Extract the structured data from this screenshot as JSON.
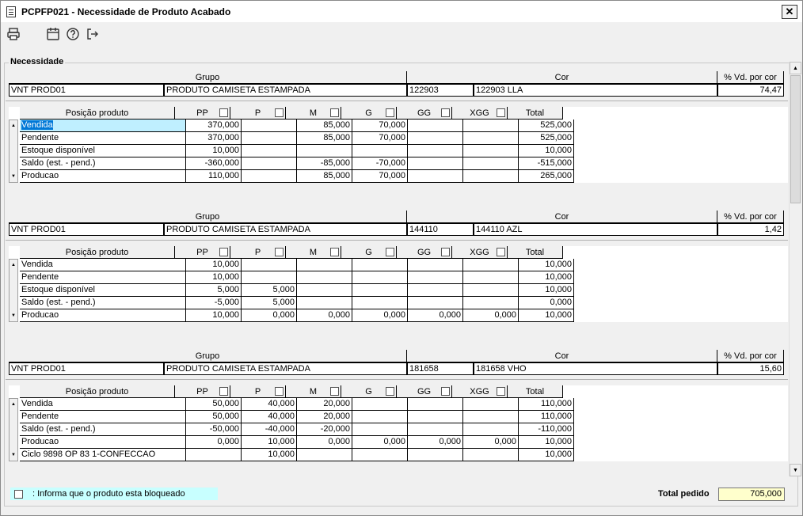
{
  "window": {
    "title": "PCPFP021 - Necessidade de Produto Acabado",
    "close_label": "✕"
  },
  "toolbar": {
    "icons": [
      "printer-icon",
      "calendar-icon",
      "help-icon",
      "exit-icon"
    ]
  },
  "groupbox_label": "Necessidade",
  "headers": {
    "grupo": "Grupo",
    "cor": "Cor",
    "pct": "% Vd. por cor"
  },
  "grid_columns": [
    "Posição produto",
    "PP",
    "P",
    "M",
    "G",
    "GG",
    "XGG",
    "Total"
  ],
  "blocks": [
    {
      "grupo_code": "VNT PROD01",
      "grupo_desc": "PRODUTO CAMISETA ESTAMPADA",
      "cor_code": "122903",
      "cor_desc": "122903 LLA",
      "pct": "74,47",
      "rows": [
        [
          "Vendida",
          "370,000",
          "",
          "85,000",
          "70,000",
          "",
          "",
          "525,000"
        ],
        [
          "Pendente",
          "370,000",
          "",
          "85,000",
          "70,000",
          "",
          "",
          "525,000"
        ],
        [
          "Estoque disponível",
          "10,000",
          "",
          "",
          "",
          "",
          "",
          "10,000"
        ],
        [
          "Saldo (est. - pend.)",
          "-360,000",
          "",
          "-85,000",
          "-70,000",
          "",
          "",
          "-515,000"
        ],
        [
          "Producao",
          "110,000",
          "",
          "85,000",
          "70,000",
          "",
          "",
          "265,000"
        ]
      ]
    },
    {
      "grupo_code": "VNT PROD01",
      "grupo_desc": "PRODUTO CAMISETA ESTAMPADA",
      "cor_code": "144110",
      "cor_desc": "144110 AZL",
      "pct": "1,42",
      "rows": [
        [
          "Vendida",
          "10,000",
          "",
          "",
          "",
          "",
          "",
          "10,000"
        ],
        [
          "Pendente",
          "10,000",
          "",
          "",
          "",
          "",
          "",
          "10,000"
        ],
        [
          "Estoque disponível",
          "5,000",
          "5,000",
          "",
          "",
          "",
          "",
          "10,000"
        ],
        [
          "Saldo (est. - pend.)",
          "-5,000",
          "5,000",
          "",
          "",
          "",
          "",
          "0,000"
        ],
        [
          "Producao",
          "10,000",
          "0,000",
          "0,000",
          "0,000",
          "0,000",
          "0,000",
          "10,000"
        ]
      ]
    },
    {
      "grupo_code": "VNT PROD01",
      "grupo_desc": "PRODUTO CAMISETA ESTAMPADA",
      "cor_code": "181658",
      "cor_desc": "181658 VHO",
      "pct": "15,60",
      "rows": [
        [
          "Vendida",
          "50,000",
          "40,000",
          "20,000",
          "",
          "",
          "",
          "110,000"
        ],
        [
          "Pendente",
          "50,000",
          "40,000",
          "20,000",
          "",
          "",
          "",
          "110,000"
        ],
        [
          "Saldo (est. - pend.)",
          "-50,000",
          "-40,000",
          "-20,000",
          "",
          "",
          "",
          "-110,000"
        ],
        [
          "Producao",
          "0,000",
          "10,000",
          "0,000",
          "0,000",
          "0,000",
          "0,000",
          "10,000"
        ],
        [
          "Ciclo 9898 OP 83  1-CONFECCAO",
          "",
          "10,000",
          "",
          "",
          "",
          "",
          "10,000"
        ]
      ]
    }
  ],
  "footer": {
    "legend_text": ": Informa que o produto esta bloqueado",
    "total_label": "Total pedido",
    "total_value": "705,000"
  },
  "colors": {
    "selection": "#0078d7",
    "highlight": "#bfefff",
    "legend_bg": "#c8ffff",
    "total_bg": "#ffffcc"
  }
}
